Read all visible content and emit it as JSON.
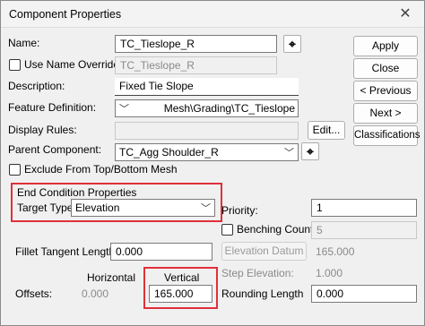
{
  "window": {
    "title": "Component Properties",
    "close_glyph": "✕"
  },
  "name": {
    "label": "Name:",
    "value": "TC_Tieslope_R"
  },
  "use_name_override": {
    "label": "Use Name Override:",
    "value": "TC_Tieslope_R",
    "checked": false
  },
  "description": {
    "label": "Description:",
    "value": "Fixed Tie Slope"
  },
  "feature_definition": {
    "label": "Feature Definition:",
    "value": "Mesh\\Grading\\TC_Tieslope"
  },
  "display_rules": {
    "label": "Display Rules:",
    "value": "",
    "edit_button": "Edit..."
  },
  "parent_component": {
    "label": "Parent Component:",
    "value": "TC_Agg Shoulder_R"
  },
  "exclude_mesh": {
    "label": "Exclude From Top/Bottom Mesh",
    "checked": false
  },
  "end_condition": {
    "group_label": "End Condition Properties",
    "target_type_label": "Target Type:",
    "target_type_value": "Elevation"
  },
  "priority": {
    "label": "Priority:",
    "value": "1"
  },
  "benching": {
    "label": "Benching Count:",
    "value": "5",
    "checked": false
  },
  "fillet": {
    "label": "Fillet Tangent Length:",
    "value": "0.000"
  },
  "elevation_datum": {
    "label": "Elevation Datum",
    "value": "165.000"
  },
  "step_elevation": {
    "label": "Step Elevation:",
    "value": "1.000"
  },
  "offsets": {
    "label": "Offsets:",
    "horizontal_label": "Horizontal",
    "horizontal_value": "0.000",
    "vertical_label": "Vertical",
    "vertical_value": "165.000"
  },
  "rounding": {
    "label": "Rounding Length",
    "value": "0.000"
  },
  "buttons": {
    "apply": "Apply",
    "close": "Close",
    "previous": "< Previous",
    "next": "Next >",
    "classifications": "Classifications"
  },
  "icons": {
    "pick": "crosshair-pick-icon",
    "dropdown": "chevron-down-icon"
  },
  "colors": {
    "highlight": "#e0303a"
  }
}
